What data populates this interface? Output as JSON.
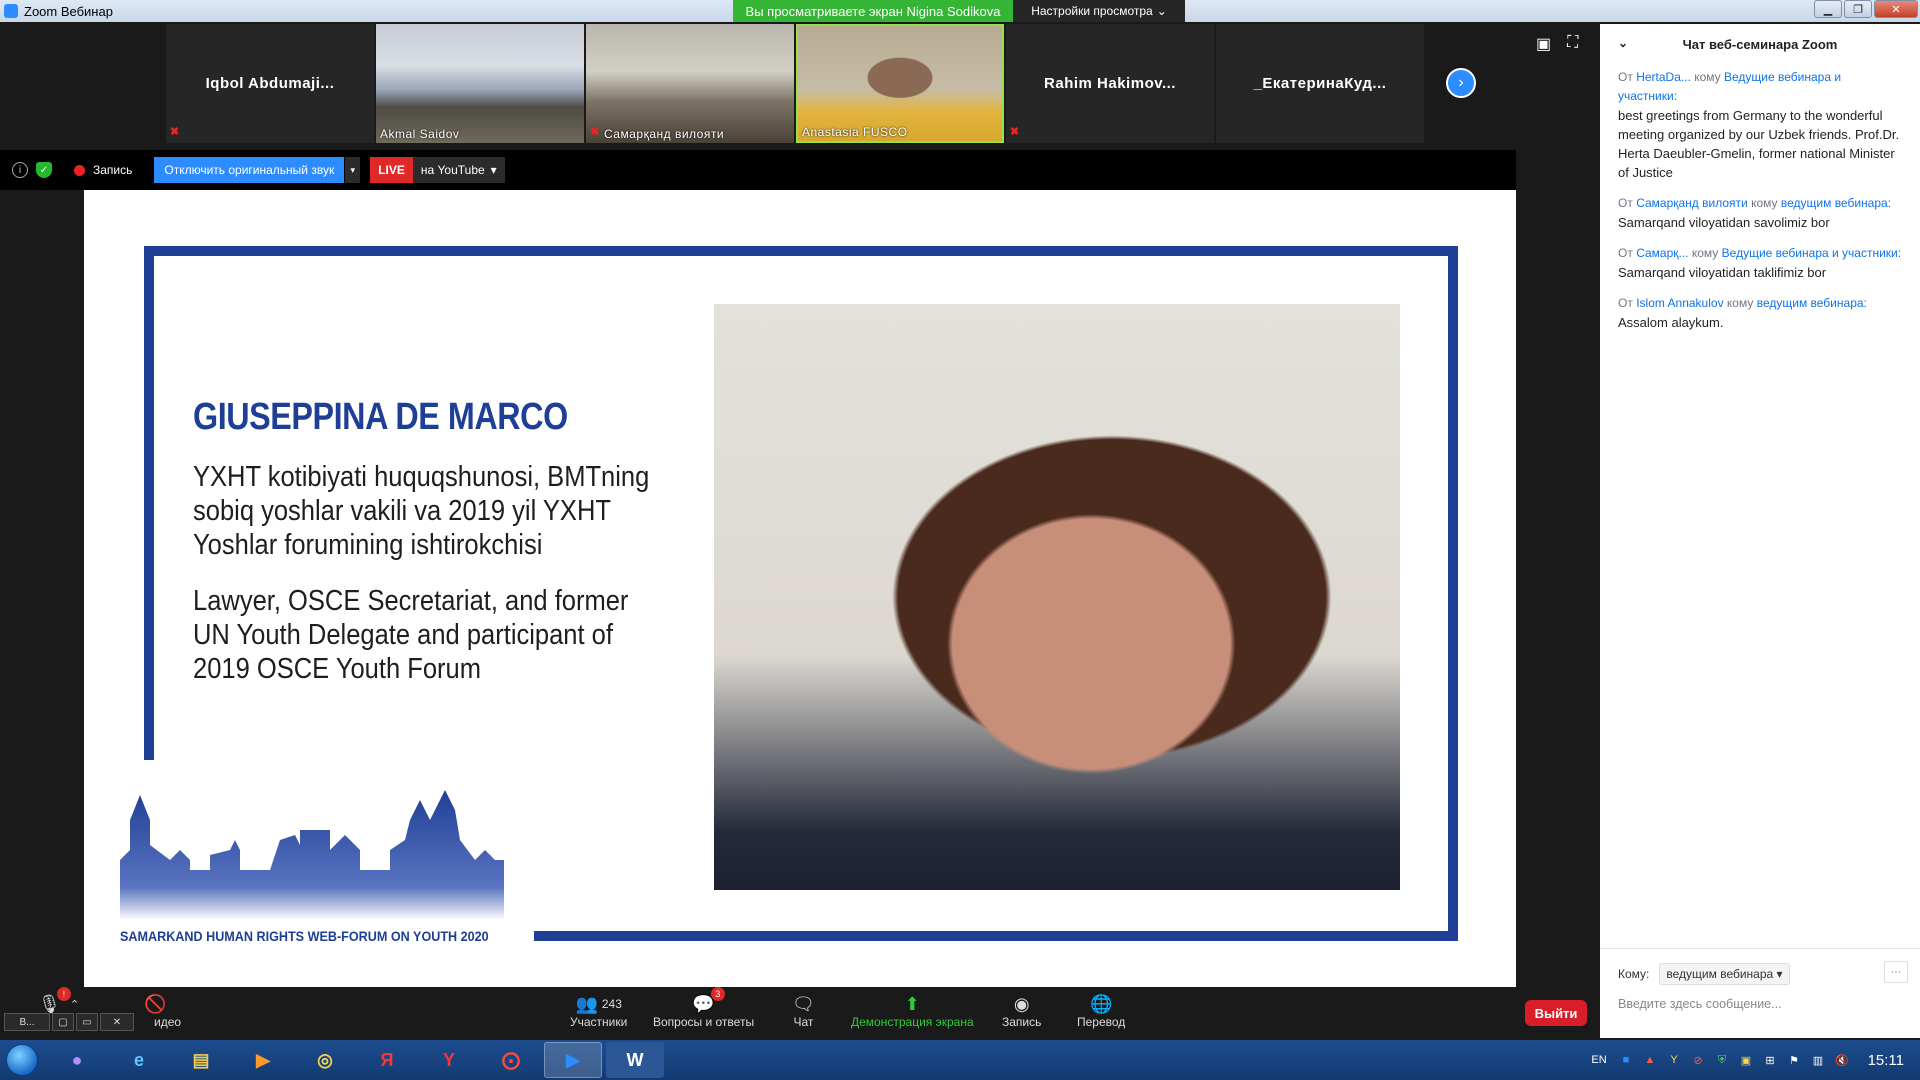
{
  "window": {
    "title": "Zoom Вебинар",
    "minimize": "▁",
    "maximize": "❐",
    "close": "✕"
  },
  "share_banner": "Вы просматриваете экран Nigina Sodikova",
  "view_options": {
    "label": "Настройки просмотра",
    "caret": "⌄"
  },
  "participants_strip": [
    {
      "name": "Iqbol  Abdumaji...",
      "muted": true
    },
    {
      "label": "Akmal Saidov",
      "muted": false
    },
    {
      "label": "Самарқанд вилояти",
      "muted": true
    },
    {
      "label": "Anastasia FUSCO",
      "muted": false
    },
    {
      "name": "Rahim  Hakimov...",
      "muted": true
    },
    {
      "name": "_ЕкатеринаКуд...",
      "muted": false
    }
  ],
  "next_page": "›",
  "meeting_bar": {
    "info": "i",
    "shield": "✓",
    "record_label": "Запись",
    "original_sound_btn": "Отключить оригинальный звук",
    "caret": "▾",
    "live_badge": "LIVE",
    "stream_target": "на YouTube"
  },
  "slide": {
    "speaker_name": "GIUSEPPINA DE MARCO",
    "bio_uz": "YXHT kotibiyati huquqshunosi, BMTning sobiq yoshlar vakili va 2019 yil YXHT Yoshlar forumining ishtirokchisi",
    "bio_en": "Lawyer, OSCE Secretariat, and former UN Youth Delegate and participant of 2019 OSCE Youth Forum",
    "logo_text": "SAMARKAND HUMAN RIGHTS WEB-FORUM ON YOUTH 2020",
    "brand_color": "#1f3f97"
  },
  "chat": {
    "title": "Чат веб-семинара Zoom",
    "collapse": "⌄",
    "messages": [
      {
        "from_prefix": "От",
        "from": "HertaDa...",
        "to_prefix": "кому",
        "to": "Ведущие вебинара и участники:",
        "text": "best greetings from Germany to the wonderful meeting organized by our Uzbek friends. Prof.Dr. Herta  Daeubler-Gmelin, former national Minister of Justice"
      },
      {
        "from_prefix": "От",
        "from": "Самарқанд вилояти",
        "to_prefix": "кому",
        "to": "ведущим вебинара:",
        "text": "Samarqand viloyatidan savolimiz bor"
      },
      {
        "from_prefix": "От",
        "from": "Самарқ...",
        "to_prefix": "кому",
        "to": "Ведущие вебинара и участники:",
        "text": "Samarqand viloyatidan taklifimiz bor"
      },
      {
        "from_prefix": "От",
        "from": "Islom Annakulov",
        "to_prefix": "кому",
        "to": "ведущим вебинара:",
        "text": "Assalom alaykum."
      }
    ],
    "to_label": "Кому:",
    "to_value": "ведущим вебинара",
    "more": "···",
    "input_placeholder": "Введите здесь сообщение..."
  },
  "controls": {
    "video_label": "идео",
    "participants_label": "Участники",
    "participants_count": "243",
    "qa_label": "Вопросы и ответы",
    "qa_badge": "3",
    "chat_label": "Чат",
    "share_label": "Демонстрация экрана",
    "record_label": "Запись",
    "translate_label": "Перевод",
    "leave": "Выйти",
    "mic_badge": "!",
    "mini_label": "В..."
  },
  "taskbar": {
    "lang": "EN",
    "clock": "15:11"
  }
}
